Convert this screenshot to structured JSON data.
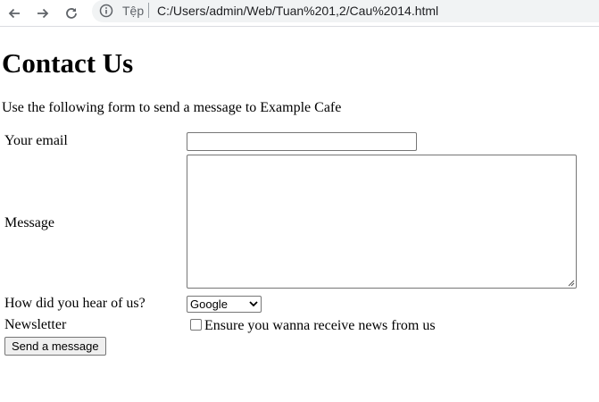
{
  "browser": {
    "scheme_label": "Tệp",
    "url": "C:/Users/admin/Web/Tuan%201,2/Cau%2014.html",
    "icons": {
      "back": "arrow-left-icon",
      "forward": "arrow-right-icon",
      "reload": "reload-icon",
      "info": "info-icon"
    }
  },
  "page": {
    "title": "Contact Us",
    "intro": "Use the following form to send a message to Example Cafe",
    "form": {
      "email_label": "Your email",
      "email_value": "",
      "message_label": "Message",
      "message_value": "",
      "hear_label": "How did you hear of us?",
      "hear_selected": "Google",
      "newsletter_label": "Newsletter",
      "newsletter_checked": false,
      "newsletter_text": "Ensure you wanna receive news from us",
      "submit_label": "Send a message"
    }
  }
}
